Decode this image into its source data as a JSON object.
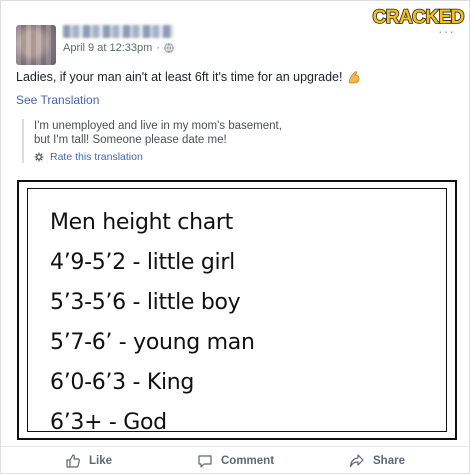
{
  "brand": {
    "logo_text": "CRACKED.COM"
  },
  "post": {
    "author_name": "John Martin Perez",
    "timestamp": "April 9 at 12:33pm",
    "separator": "·",
    "audience_icon": "globe-icon",
    "options_label": "···",
    "text": "Ladies, if your man ain't at least 6ft it's time for an upgrade!",
    "text_emoji": "flexed-arm-emoji"
  },
  "translation": {
    "see_translation_label": "See Translation",
    "lines": [
      "I'm unemployed and live in my mom's basement,",
      "but I'm tall! Someone please date me!"
    ],
    "rate_label": "Rate this translation",
    "rate_icon": "gear-icon"
  },
  "image": {
    "lines": [
      "Men height chart",
      "4’9-5’2  - little girl",
      "5’3-5’6  - little boy",
      "5’7-6’  - young man",
      "6’0-6’3 - King",
      "6’3+ - God"
    ]
  },
  "actions": {
    "like_label": "Like",
    "comment_label": "Comment",
    "share_label": "Share",
    "like_icon": "thumbs-up-icon",
    "comment_icon": "comment-bubble-icon",
    "share_icon": "share-arrow-icon"
  },
  "colors": {
    "link": "#4267b2",
    "brand_yellow": "#f6c019",
    "muted": "#616770"
  }
}
